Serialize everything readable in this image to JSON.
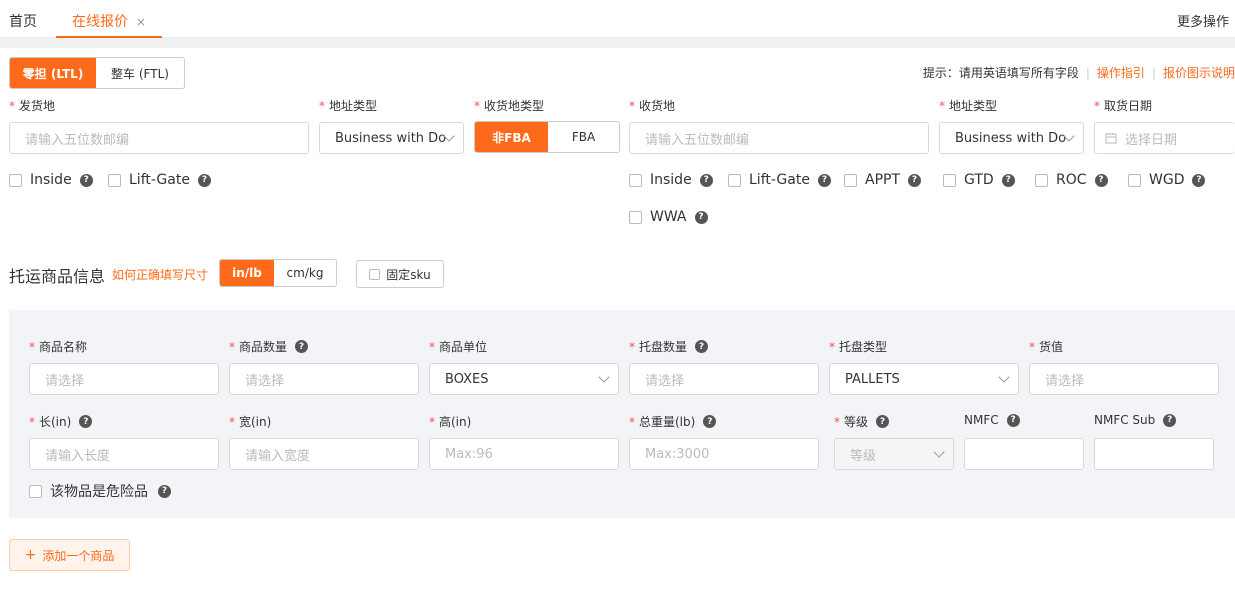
{
  "tabs": {
    "home": "首页",
    "active": "在线报价",
    "close": "×",
    "more": "更多操作"
  },
  "mode": {
    "ltl": "零担 (LTL)",
    "ftl": "整车 (FTL)"
  },
  "hint": {
    "prefix": "提示：请用英语填写所有字段",
    "guide": "操作指引",
    "explain": "报价图示说明"
  },
  "origin": {
    "label": "发货地",
    "placeholder": "请输入五位数邮编",
    "addr_type_label": "地址类型",
    "addr_type_value": "Business with Do",
    "accessorials": [
      "Inside",
      "Lift-Gate"
    ]
  },
  "dest_type": {
    "label": "收货地类型",
    "non_fba": "非FBA",
    "fba": "FBA"
  },
  "destination": {
    "label": "收货地",
    "placeholder": "请输入五位数邮编",
    "addr_type_label": "地址类型",
    "addr_type_value": "Business with Do",
    "pickup_label": "取货日期",
    "pickup_placeholder": "选择日期",
    "accessorials": [
      "Inside",
      "Lift-Gate",
      "APPT",
      "GTD",
      "ROC",
      "WGD",
      "WWA"
    ]
  },
  "goods": {
    "title": "托运商品信息",
    "size_link": "如何正确填写尺寸",
    "unit_in": "in/lb",
    "unit_cm": "cm/kg",
    "fixed_sku": "固定sku",
    "name_label": "商品名称",
    "name_ph": "请选择",
    "qty_label": "商品数量",
    "qty_ph": "请选择",
    "unit_label": "商品单位",
    "unit_value": "BOXES",
    "pallet_qty_label": "托盘数量",
    "pallet_qty_ph": "请选择",
    "pallet_type_label": "托盘类型",
    "pallet_type_value": "PALLETS",
    "value_label": "货值",
    "value_ph": "请选择",
    "len_label": "长(in)",
    "len_ph": "请输入长度",
    "wid_label": "宽(in)",
    "wid_ph": "请输入宽度",
    "hgt_label": "高(in)",
    "hgt_ph": "Max:96",
    "weight_label": "总重量(lb)",
    "weight_ph": "Max:3000",
    "class_label": "等级",
    "class_ph": "等级",
    "nmfc_label": "NMFC",
    "nmfc_sub_label": "NMFC Sub",
    "hazard": "该物品是危险品"
  },
  "add_item": "添加一个商品",
  "colors": {
    "accent": "#ff6a1a",
    "required": "#ff4d4f",
    "panel": "#f2f4f7"
  },
  "icons": {
    "help": "question-circle-icon",
    "calendar": "calendar-icon",
    "chevron": "chevron-down-icon",
    "plus": "plus-icon"
  }
}
